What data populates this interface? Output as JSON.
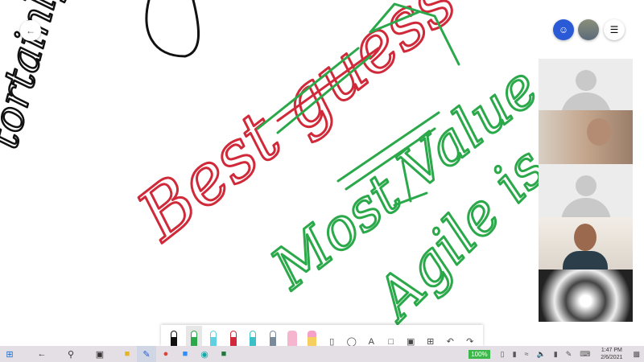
{
  "whiteboard": {
    "ink": [
      {
        "text": "tortainly",
        "color": "#111111"
      },
      {
        "text": "Best guess",
        "color": "#d02a3a"
      },
      {
        "text": "Most Value",
        "color": "#2aa84a"
      },
      {
        "text": "Agile is",
        "color": "#2aa84a"
      }
    ]
  },
  "toolbar": {
    "tools": [
      "black-pen",
      "green-pen",
      "cyan-pen",
      "red-pen",
      "teal-pen",
      "gray-pen",
      "highlighter",
      "eraser",
      "ruler",
      "lasso",
      "A",
      "note",
      "image",
      "add",
      "undo",
      "redo"
    ],
    "text_tool": "A"
  },
  "taskbar": {
    "battery": "100%",
    "time": "1:47 PM",
    "date": "2/6/2021"
  },
  "colors": {
    "red_ink": "#d02a3a",
    "green_ink": "#2aa84a",
    "accent": "#2b5ad6"
  }
}
